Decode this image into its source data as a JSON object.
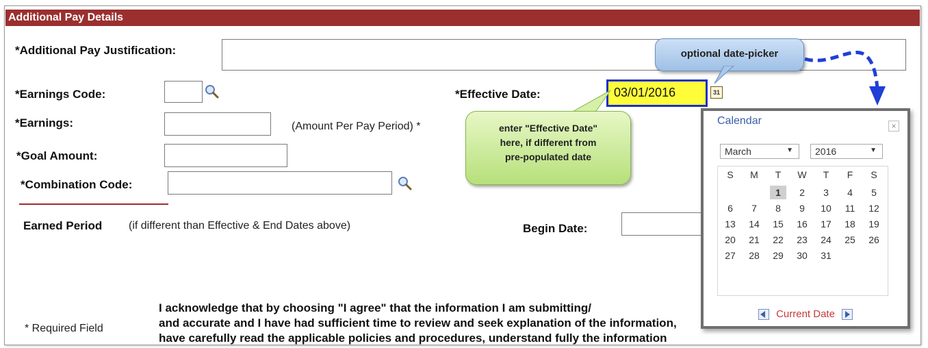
{
  "section_title": "Additional Pay Details",
  "fields": {
    "justification_label": "*Additional Pay Justification:",
    "earnings_code_label": "*Earnings Code:",
    "effective_date_label": "*Effective Date:",
    "effective_date_value": "03/01/2016",
    "earnings_label": "*Earnings:",
    "amount_note": "(Amount Per Pay Period) *",
    "goal_amount_label": "*Goal Amount:",
    "combination_code_label": "*Combination Code:",
    "earned_period_label": "Earned Period",
    "earned_period_note": "(if different than Effective & End Dates above)",
    "begin_date_label": "Begin Date:"
  },
  "footer": {
    "required_note": "* Required Field",
    "acknowledge_line1": "I acknowledge that by choosing \"I agree\" that the information I am submitting/",
    "acknowledge_line2": "and accurate and I have had sufficient time to review and seek explanation of the information,",
    "acknowledge_line3": "have carefully read the applicable policies and procedures, understand fully the information"
  },
  "callouts": {
    "date_picker": "optional date-picker",
    "effective_line1": "enter \"Effective Date\"",
    "effective_line2": "here, if different from",
    "effective_line3": "pre-populated date"
  },
  "calendar": {
    "title": "Calendar",
    "close": "×",
    "month": "March",
    "year": "2016",
    "day_headers": [
      "S",
      "M",
      "T",
      "W",
      "T",
      "F",
      "S"
    ],
    "weeks": [
      [
        "",
        "",
        "1",
        "2",
        "3",
        "4",
        "5"
      ],
      [
        "6",
        "7",
        "8",
        "9",
        "10",
        "11",
        "12"
      ],
      [
        "13",
        "14",
        "15",
        "16",
        "17",
        "18",
        "19"
      ],
      [
        "20",
        "21",
        "22",
        "23",
        "24",
        "25",
        "26"
      ],
      [
        "27",
        "28",
        "29",
        "30",
        "31",
        "",
        ""
      ]
    ],
    "selected_day": "1",
    "current_date_label": "Current Date",
    "cal_icon_label": "31"
  },
  "colors": {
    "header_bg": "#9b2f2f",
    "highlight_border": "#1a2fc9",
    "highlight_fill": "#fffd3a",
    "arrow": "#1f3fd6"
  }
}
